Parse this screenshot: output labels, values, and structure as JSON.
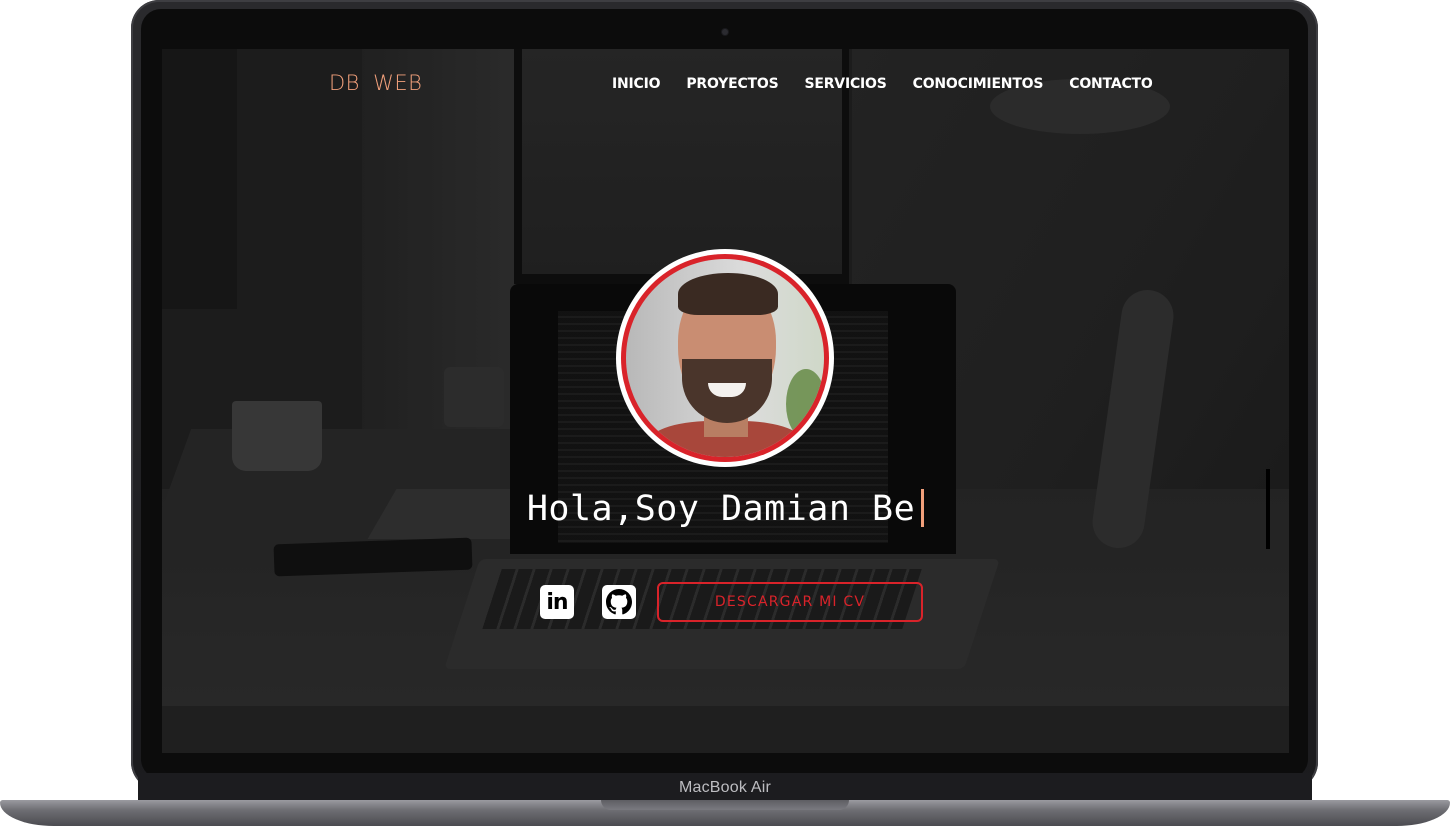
{
  "device": {
    "label": "MacBook Air"
  },
  "site": {
    "brand": "DB WEB",
    "nav": [
      "INICIO",
      "PROYECTOS",
      "SERVICIOS",
      "CONOCIMIENTOS",
      "CONTACTO"
    ]
  },
  "hero": {
    "headline": "Hola,Soy Damian Be",
    "social": [
      {
        "name": "linkedin-icon",
        "glyph": "in"
      },
      {
        "name": "github-icon"
      }
    ],
    "cv_button": "DESCARGAR MI CV"
  },
  "colors": {
    "accent": "#f2a07b",
    "button": "#d9232a"
  }
}
